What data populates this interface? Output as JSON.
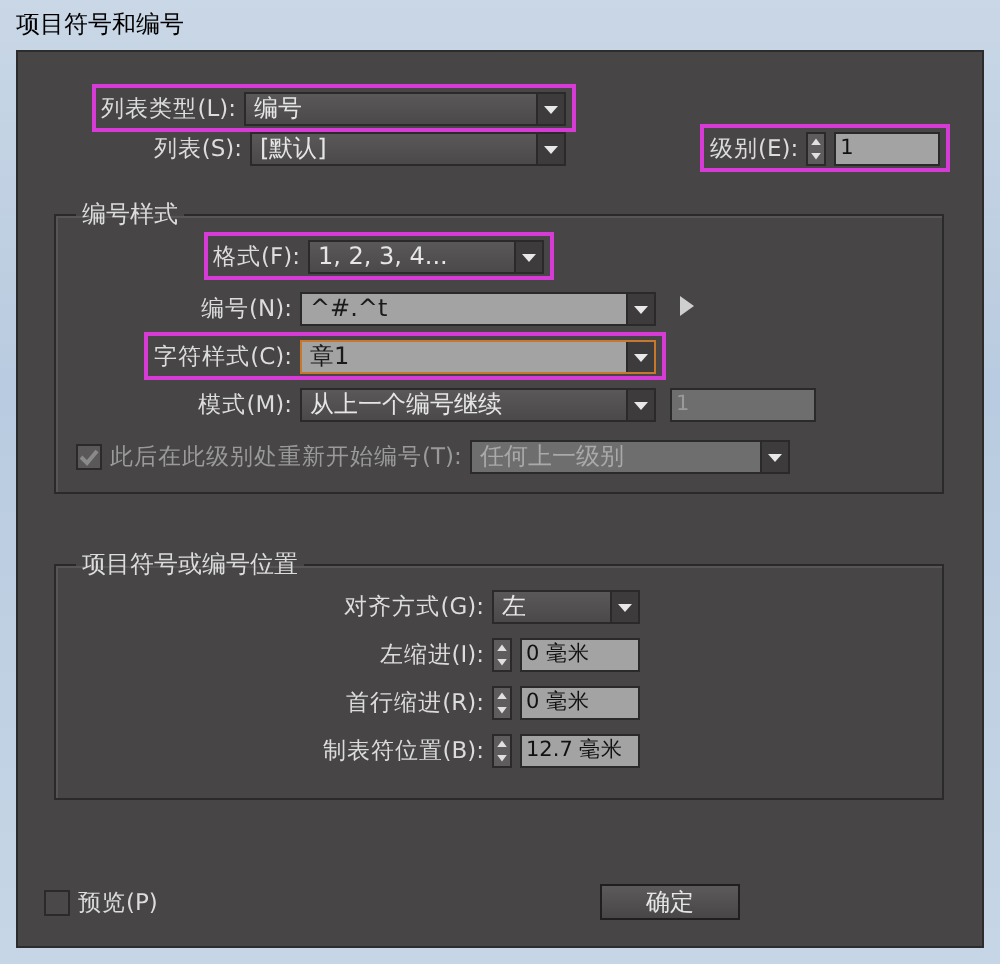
{
  "window": {
    "title": "项目符号和编号"
  },
  "list_type": {
    "label": "列表类型(L):",
    "value": "编号",
    "highlighted": true
  },
  "list": {
    "label": "列表(S):",
    "value": "[默认]",
    "highlighted": false
  },
  "level": {
    "label": "级别(E):",
    "value": "1",
    "highlighted": true
  },
  "numbering_style": {
    "title": "编号样式",
    "rows": [
      {
        "kind": "select",
        "label": "格式(F):",
        "value": "1, 2, 3, 4...",
        "highlighted": true
      },
      {
        "kind": "combo",
        "label": "编号(N):",
        "value": "^#.^t",
        "highlighted": false,
        "focused": false,
        "flyout": true
      },
      {
        "kind": "combo",
        "label": "字符样式(C):",
        "value": "章1",
        "highlighted": true,
        "focused": true
      },
      {
        "kind": "select",
        "label": "模式(M):",
        "value": "从上一个编号继续",
        "highlighted": false,
        "extra": {
          "value": "1",
          "disabled": true
        }
      }
    ],
    "restart": {
      "label": "此后在此级别处重新开始编号(T):",
      "checked": true,
      "disabled": true,
      "value": "任何上一级别"
    }
  },
  "position": {
    "title": "项目符号或编号位置",
    "rows": [
      {
        "kind": "select",
        "label": "对齐方式(G):",
        "value": "左"
      },
      {
        "kind": "spinner",
        "label": "左缩进(I):",
        "value": "0 毫米"
      },
      {
        "kind": "spinner",
        "label": "首行缩进(R):",
        "value": "0 毫米"
      },
      {
        "kind": "spinner",
        "label": "制表符位置(B):",
        "value": "12.7 毫米"
      }
    ]
  },
  "preview": {
    "label": "预览(P)",
    "checked": false
  },
  "buttons": [
    "确定"
  ]
}
